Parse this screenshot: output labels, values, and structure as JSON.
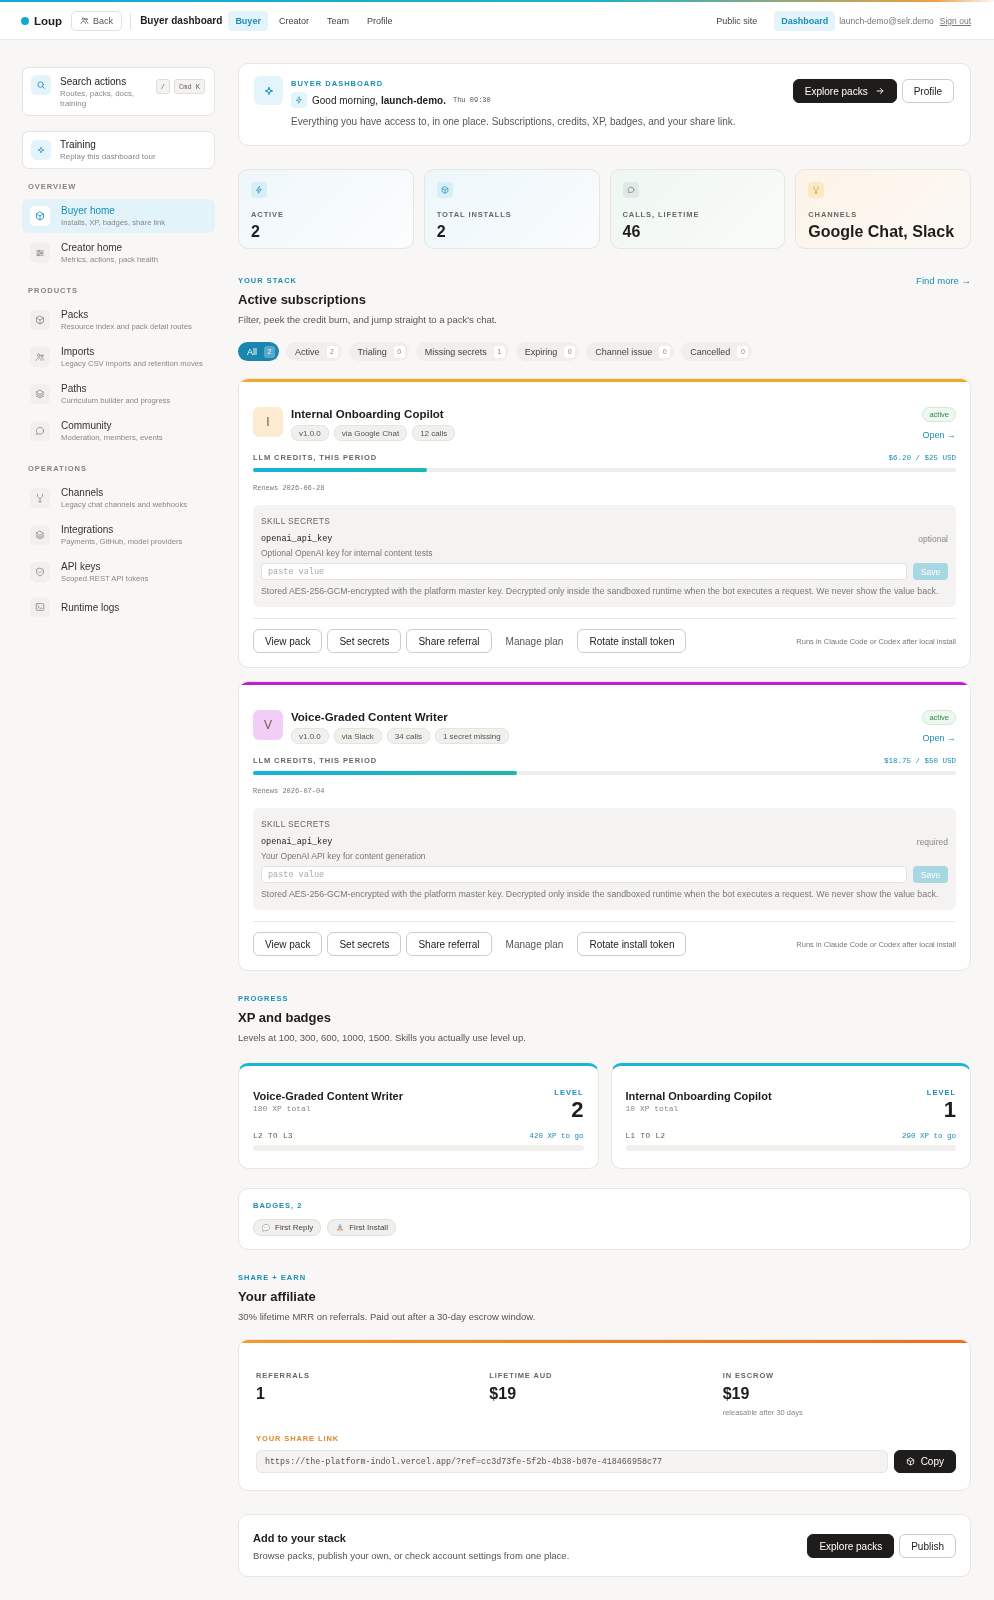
{
  "topbar": {
    "brand": "Loup",
    "back": "Back",
    "title": "Buyer dashboard",
    "tabs": [
      {
        "label": "Buyer",
        "selected": true
      },
      {
        "label": "Creator",
        "selected": false
      },
      {
        "label": "Team",
        "selected": false
      },
      {
        "label": "Profile",
        "selected": false
      }
    ],
    "links": [
      {
        "label": "Public site",
        "selected": false
      },
      {
        "label": "Dashboard",
        "selected": true
      }
    ],
    "email": "launch-demo@selr.demo",
    "sign_out": "Sign out"
  },
  "sidebar": {
    "search": {
      "title": "Search actions",
      "subtitle": "Routes, packs, docs, training",
      "keys": [
        "/",
        "Cmd K"
      ]
    },
    "training": {
      "title": "Training",
      "subtitle": "Replay this dashboard tour"
    },
    "sections": [
      {
        "label": "OVERVIEW",
        "items": [
          {
            "title": "Buyer home",
            "subtitle": "Installs, XP, badges, share link",
            "selected": true
          },
          {
            "title": "Creator home",
            "subtitle": "Metrics, actions, pack health",
            "selected": false
          }
        ]
      },
      {
        "label": "PRODUCTS",
        "items": [
          {
            "title": "Packs",
            "subtitle": "Resource index and pack detail routes",
            "selected": false
          },
          {
            "title": "Imports",
            "subtitle": "Legacy CSV imports and retention moves",
            "selected": false
          },
          {
            "title": "Paths",
            "subtitle": "Curriculum builder and progress",
            "selected": false
          },
          {
            "title": "Community",
            "subtitle": "Moderation, members, events",
            "selected": false
          }
        ]
      },
      {
        "label": "OPERATIONS",
        "items": [
          {
            "title": "Channels",
            "subtitle": "Legacy chat channels and webhooks",
            "selected": false
          },
          {
            "title": "Integrations",
            "subtitle": "Payments, GitHub, model providers",
            "selected": false
          },
          {
            "title": "API keys",
            "subtitle": "Scoped REST API tokens",
            "selected": false
          },
          {
            "title": "Runtime logs",
            "selected": false
          }
        ]
      }
    ]
  },
  "hero": {
    "eyebrow": "BUYER DASHBOARD",
    "greeting": "Good morning, **launch-demo.**",
    "time": "Thu 09:30",
    "description": "Everything you have access to, in one place. Subscriptions, credits, XP, badges, and your share link.",
    "buttons": [
      {
        "label": "Explore packs",
        "kind": "primary",
        "arrow": true
      },
      {
        "label": "Profile",
        "kind": "outline",
        "arrow": false
      }
    ]
  },
  "stats": [
    {
      "label": "ACTIVE",
      "value": "2"
    },
    {
      "label": "TOTAL INSTALLS",
      "value": "2"
    },
    {
      "label": "CALLS, LIFETIME",
      "value": "46"
    },
    {
      "label": "CHANNELS",
      "value": "Google Chat, Slack"
    }
  ],
  "stack": {
    "eyebrow": "YOUR STACK",
    "title": "Active subscriptions",
    "subtitle": "Filter, peek the credit burn, and jump straight to a pack's chat.",
    "link": "Find more →",
    "filters": [
      {
        "label": "All",
        "count": "2",
        "selected": true
      },
      {
        "label": "Active",
        "count": "2",
        "selected": false
      },
      {
        "label": "Trialing",
        "count": "0",
        "selected": false
      },
      {
        "label": "Missing secrets",
        "count": "1",
        "selected": false
      },
      {
        "label": "Expiring",
        "count": "0",
        "selected": false
      },
      {
        "label": "Channel issue",
        "count": "0",
        "selected": false
      },
      {
        "label": "Cancelled",
        "count": "0",
        "selected": false
      }
    ],
    "subscriptions": [
      {
        "initial": "I",
        "name": "Internal Onboarding Copilot",
        "color": "#f0a52c",
        "tags": [
          "v1.0.0",
          "via Google Chat",
          "12 calls"
        ],
        "status": "active",
        "open": "Open →",
        "credits_label": "LLM CREDITS, THIS PERIOD",
        "credits_reading": "$6.20 / $25 USD",
        "level": 0.248,
        "renews": "Renews 2026-06-28",
        "secret": {
          "heading": "SKILL SECRETS",
          "key": "openai_api_key",
          "requirement": "optional",
          "description": "Optional OpenAI key for internal content tests",
          "placeholder": "paste value",
          "save": {
            "label": "Save",
            "disabled": true
          },
          "note": "Stored AES-256-GCM-encrypted with the platform master key. Decrypted only inside the sandboxed runtime when the bot executes a request. We never show the value back."
        },
        "actions": [
          {
            "label": "View pack",
            "kind": "outline"
          },
          {
            "label": "Set secrets",
            "kind": "outline"
          },
          {
            "label": "Share referral",
            "kind": "outline"
          },
          {
            "label": "Manage plan",
            "kind": "plain"
          },
          {
            "label": "Rotate install token",
            "kind": "outline"
          }
        ],
        "footnote": "Runs in Claude Code or Codex after local install"
      },
      {
        "initial": "V",
        "name": "Voice-Graded Content Writer",
        "color": "#c21ed6",
        "tags": [
          "v1.0.0",
          "via Slack",
          "34 calls",
          "1 secret missing"
        ],
        "status": "active",
        "open": "Open →",
        "credits_label": "LLM CREDITS, THIS PERIOD",
        "credits_reading": "$18.75 / $50 USD",
        "level": 0.375,
        "renews": "Renews 2026-07-04",
        "secret": {
          "heading": "SKILL SECRETS",
          "key": "openai_api_key",
          "requirement": "required",
          "description": "Your OpenAI API key for content generation",
          "placeholder": "paste value",
          "save": {
            "label": "Save",
            "disabled": true
          },
          "note": "Stored AES-256-GCM-encrypted with the platform master key. Decrypted only inside the sandboxed runtime when the bot executes a request. We never show the value back."
        },
        "actions": [
          {
            "label": "View pack",
            "kind": "outline"
          },
          {
            "label": "Set secrets",
            "kind": "outline"
          },
          {
            "label": "Share referral",
            "kind": "outline"
          },
          {
            "label": "Manage plan",
            "kind": "plain"
          },
          {
            "label": "Rotate install token",
            "kind": "outline"
          }
        ],
        "footnote": "Runs in Claude Code or Codex after local install"
      }
    ]
  },
  "progress": {
    "eyebrow": "PROGRESS",
    "title": "XP and badges",
    "subtitle": "Levels at 100, 300, 600, 1000, 1500. Skills you actually use level up.",
    "skills": [
      {
        "name": "Voice-Graded Content Writer",
        "xp": "180 XP total",
        "level_label": "LEVEL",
        "level_value": "2",
        "range": "L2 TO L3",
        "to_go": "420 XP to go"
      },
      {
        "name": "Internal Onboarding Copilot",
        "xp": "10 XP total",
        "level_label": "LEVEL",
        "level_value": "1",
        "range": "L1 TO L2",
        "to_go": "290 XP to go"
      }
    ],
    "badges": {
      "title": "BADGES, 2",
      "items": [
        "First Reply",
        "First Install"
      ]
    }
  },
  "affiliate": {
    "eyebrow": "SHARE + EARN",
    "title": "Your affiliate",
    "subtitle": "30% lifetime MRR on referrals. Paid out after a 30-day escrow window.",
    "stats": [
      {
        "label": "REFERRALS",
        "value": "1"
      },
      {
        "label": "LIFETIME AUD",
        "value": "$19"
      },
      {
        "label": "IN ESCROW",
        "value": "$19",
        "note": "releasable after 30 days"
      }
    ],
    "link_label": "YOUR SHARE LINK",
    "link": "https://the-platform-indol.vercel.app/?ref=cc3d73fe-5f2b-4b38-b07e-418466958c77",
    "copy": "Copy"
  },
  "cta": {
    "title": "Add to your stack",
    "subtitle": "Browse packs, publish your own, or check account settings from one place.",
    "buttons": [
      {
        "label": "Explore packs",
        "kind": "primary",
        "arrow": false
      },
      {
        "label": "Publish",
        "kind": "outline",
        "arrow": false
      }
    ]
  }
}
